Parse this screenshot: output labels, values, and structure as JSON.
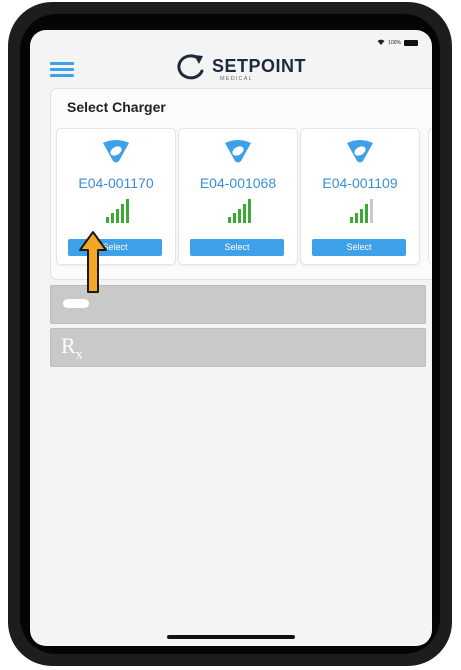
{
  "status": {
    "battery_text": "100%"
  },
  "header": {
    "brand_name": "SETPOINT",
    "brand_sub": "MEDICAL"
  },
  "charger_panel": {
    "title": "Select Charger",
    "chargers": [
      {
        "serial": "E04-001170",
        "button_label": "Select",
        "signal_bars": 5
      },
      {
        "serial": "E04-001068",
        "button_label": "Select",
        "signal_bars": 5
      },
      {
        "serial": "E04-001109",
        "button_label": "Select",
        "signal_bars": 4
      }
    ]
  },
  "rows": [
    {
      "icon": "implant-icon"
    },
    {
      "icon": "rx-icon",
      "glyph_main": "R",
      "glyph_sub": "x"
    }
  ],
  "colors": {
    "accent": "#3ea0e8",
    "serial_text": "#3b8fd6",
    "signal_green": "#3aaa35",
    "arrow_fill": "#f5a623",
    "arrow_stroke": "#1a1a1a"
  }
}
